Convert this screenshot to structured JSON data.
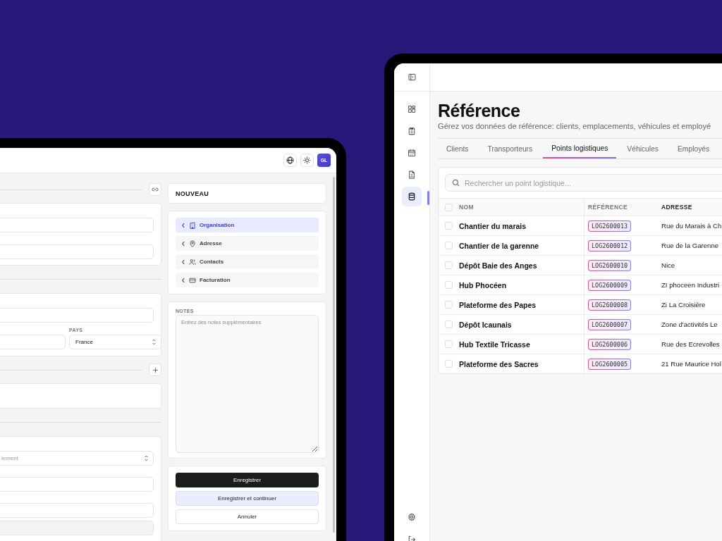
{
  "left_app": {
    "header": {
      "avatar": "GL"
    },
    "form": {
      "country_label": "PAYS",
      "country_value": "France",
      "payment_placeholder": "iement"
    },
    "panel": {
      "title": "NOUVEAU",
      "nav": [
        {
          "label": "Organisation",
          "kind": "building",
          "selected": true
        },
        {
          "label": "Adresse",
          "kind": "pin",
          "selected": false
        },
        {
          "label": "Contacts",
          "kind": "people",
          "selected": false
        },
        {
          "label": "Facturation",
          "kind": "card",
          "selected": false
        }
      ],
      "notes": {
        "label": "NOTES",
        "placeholder": "Entrez des notes supplémentaires"
      },
      "buttons": [
        {
          "label": "Enregistrer",
          "kind": "primary"
        },
        {
          "label": "Enregistrer et continuer",
          "kind": "secondary"
        },
        {
          "label": "Annuler",
          "kind": "outline"
        }
      ]
    }
  },
  "right_app": {
    "sidebar": {
      "items": [
        {
          "kind": "dashboard",
          "selected": false
        },
        {
          "kind": "clipboard",
          "selected": false
        },
        {
          "kind": "calendar",
          "selected": false
        },
        {
          "kind": "document",
          "selected": false
        },
        {
          "kind": "database",
          "selected": true
        }
      ]
    },
    "title": "Référence",
    "subtitle": "Gérez vos données de référence: clients, emplacements, véhicules et employé",
    "tabs": [
      {
        "label": "Clients",
        "selected": false
      },
      {
        "label": "Transporteurs",
        "selected": false
      },
      {
        "label": "Points logistiques",
        "selected": true
      },
      {
        "label": "Véhicules",
        "selected": false
      },
      {
        "label": "Employés",
        "selected": false
      }
    ],
    "search": {
      "placeholder": "Rechercher un point logistique..."
    },
    "table": {
      "select_all": {
        "checked": false
      },
      "columns": [
        "NOM",
        "RÉFÉRENCE",
        "ADRESSE"
      ],
      "rows": [
        {
          "name": "Chantier du marais",
          "reference": "LOG2600013",
          "address": "Rue du Marais à Ch",
          "checked": false
        },
        {
          "name": "Chantier de la garenne",
          "reference": "LOG2600012",
          "address": "Rue de la Garenne",
          "checked": false
        },
        {
          "name": "Dépôt Baie des Anges",
          "reference": "LOG2600010",
          "address": "Nice",
          "checked": false
        },
        {
          "name": "Hub Phocéen",
          "reference": "LOG2600009",
          "address": "ZI phoceen Industri",
          "checked": false
        },
        {
          "name": "Plateforme des Papes",
          "reference": "LOG2600008",
          "address": "Zi La Croisière",
          "checked": false
        },
        {
          "name": "Dépôt Icaunais",
          "reference": "LOG2600007",
          "address": "Zone d'activités Le",
          "checked": false
        },
        {
          "name": "Hub Textile Tricasse",
          "reference": "LOG2600006",
          "address": "Rue des Ecrevolles",
          "checked": false
        },
        {
          "name": "Plateforme des Sacres",
          "reference": "LOG2600005",
          "address": "21 Rue Maurice Hol",
          "checked": false
        }
      ]
    }
  }
}
